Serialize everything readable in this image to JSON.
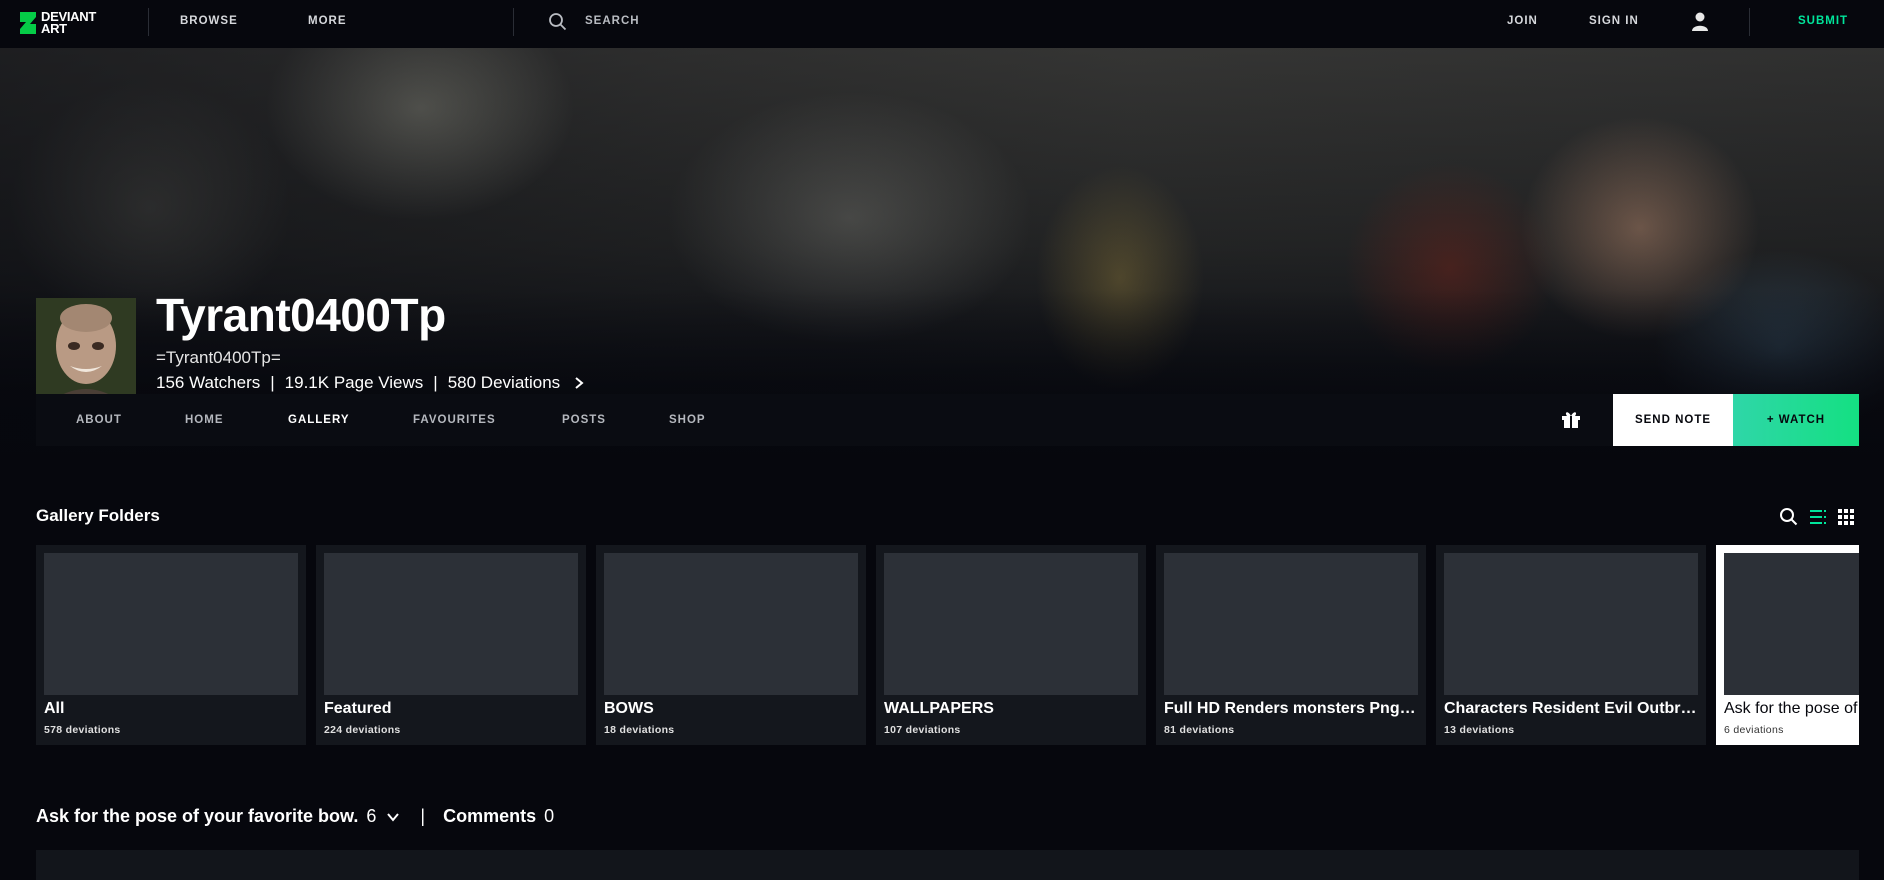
{
  "topbar": {
    "logo_text_line1": "DEVIANT",
    "logo_text_line2": "ART",
    "browse": "BROWSE",
    "more": "MORE",
    "search": "SEARCH",
    "join": "JOIN",
    "sign_in": "SIGN IN",
    "submit": "SUBMIT",
    "icons": [
      "search-icon",
      "user-icon"
    ]
  },
  "profile": {
    "username": "Tyrant0400Tp",
    "handle": "=Tyrant0400Tp=",
    "watchers": "156 Watchers",
    "page_views": "19.1K Page Views",
    "deviations": "580 Deviations",
    "separator": "|"
  },
  "profile_nav": {
    "tabs": [
      "ABOUT",
      "HOME",
      "GALLERY",
      "FAVOURITES",
      "POSTS",
      "SHOP"
    ],
    "active_tab": "GALLERY",
    "send_note": "SEND NOTE",
    "watch": "+ WATCH"
  },
  "gallery": {
    "title": "Gallery Folders",
    "folders": [
      {
        "name": "All",
        "count": "578 deviations"
      },
      {
        "name": "Featured",
        "count": "224 deviations"
      },
      {
        "name": "BOWS",
        "count": "18 deviations"
      },
      {
        "name": "WALLPAPERS",
        "count": "107 deviations"
      },
      {
        "name": "Full HD Renders monsters Png. Resident Evil",
        "count": "81 deviations"
      },
      {
        "name": "Characters Resident Evil Outbreak",
        "count": "13 deviations"
      },
      {
        "name": "Ask for the pose of your favorite bow.",
        "count": "6 deviations"
      }
    ],
    "selected_folder": {
      "name": "Ask for the pose of your favorite bow.",
      "count": "6",
      "comments_label": "Comments",
      "comments_count": "0",
      "separator": "|"
    }
  },
  "colors": {
    "background": "#06070d",
    "accent_green": "#00e59b",
    "card": "#14171d",
    "thumb": "#2c3037"
  }
}
